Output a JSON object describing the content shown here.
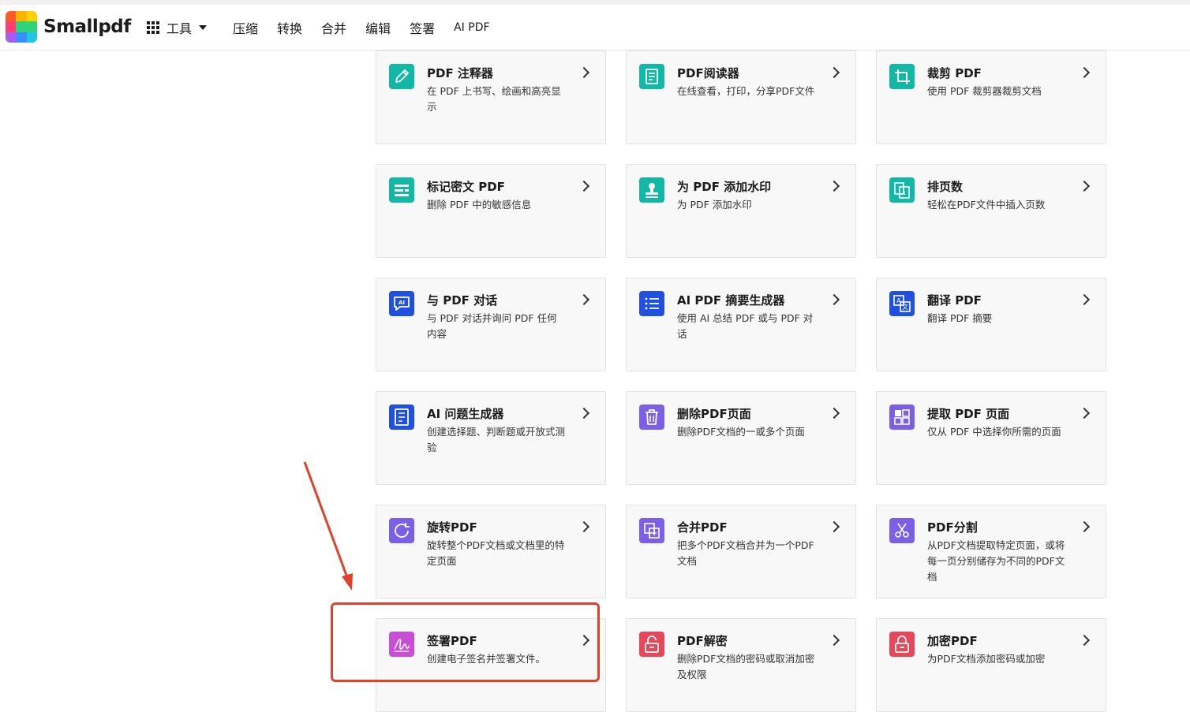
{
  "header": {
    "logo_text": "Smallpdf",
    "tools_label": "工具",
    "nav": [
      "压缩",
      "转换",
      "合并",
      "编辑",
      "签署",
      "AI PDF"
    ]
  },
  "colors": {
    "teal": "#12b8a6",
    "blue": "#2050e0",
    "purple": "#7b5fe6",
    "magenta": "#c64fd6",
    "red": "#e8475a",
    "annotation_red": "#e0412a"
  },
  "cards": [
    {
      "title": "PDF 注释器",
      "desc": "在 PDF 上书写、绘画和高亮显示",
      "icon": "pencil-icon",
      "color": "#12b8a6"
    },
    {
      "title": "PDF阅读器",
      "desc": "在线查看，打印，分享PDF文件",
      "icon": "document-icon",
      "color": "#12b8a6"
    },
    {
      "title": "裁剪 PDF",
      "desc": "使用 PDF 裁剪器裁剪文档",
      "icon": "crop-icon",
      "color": "#12b8a6"
    },
    {
      "title": "标记密文 PDF",
      "desc": "删除 PDF 中的敏感信息",
      "icon": "redact-icon",
      "color": "#12b8a6"
    },
    {
      "title": "为 PDF 添加水印",
      "desc": "为 PDF 添加水印",
      "icon": "stamp-icon",
      "color": "#12b8a6"
    },
    {
      "title": "排页数",
      "desc": "轻松在PDF文件中插入页数",
      "icon": "page-number-icon",
      "color": "#12b8a6"
    },
    {
      "title": "与 PDF 对话",
      "desc": "与 PDF 对话并询问 PDF 任何内容",
      "icon": "ai-chat-icon",
      "color": "#2050e0"
    },
    {
      "title": "AI PDF 摘要生成器",
      "desc": "使用 AI 总结 PDF 或与 PDF 对话",
      "icon": "list-icon",
      "color": "#2050e0"
    },
    {
      "title": "翻译 PDF",
      "desc": "翻译 PDF 摘要",
      "icon": "translate-icon",
      "color": "#2050e0"
    },
    {
      "title": "AI 问题生成器",
      "desc": "创建选择题、判断题或开放式测验",
      "icon": "quiz-icon",
      "color": "#2050e0"
    },
    {
      "title": "删除PDF页面",
      "desc": "删除PDF文档的一或多个页面",
      "icon": "trash-icon",
      "color": "#7b5fe6"
    },
    {
      "title": "提取 PDF 页面",
      "desc": "仅从 PDF 中选择你所需的页面",
      "icon": "extract-icon",
      "color": "#7b5fe6"
    },
    {
      "title": "旋转PDF",
      "desc": "旋转整个PDF文档或文档里的特定页面",
      "icon": "rotate-icon",
      "color": "#7b5fe6"
    },
    {
      "title": "合并PDF",
      "desc": "把多个PDF文档合并为一个PDF文档",
      "icon": "merge-icon",
      "color": "#7b5fe6"
    },
    {
      "title": "PDF分割",
      "desc": "从PDF文档提取特定页面，或将每一页分别储存为不同的PDF文档",
      "icon": "scissors-icon",
      "color": "#7b5fe6"
    },
    {
      "title": "签署PDF",
      "desc": "创建电子签名并签署文件。",
      "icon": "signature-icon",
      "color": "#c64fd6"
    },
    {
      "title": "PDF解密",
      "desc": "删除PDF文档的密码或取消加密及权限",
      "icon": "unlock-icon",
      "color": "#e8475a"
    },
    {
      "title": "加密PDF",
      "desc": "为PDF文档添加密码或加密",
      "icon": "lock-icon",
      "color": "#e8475a"
    }
  ]
}
